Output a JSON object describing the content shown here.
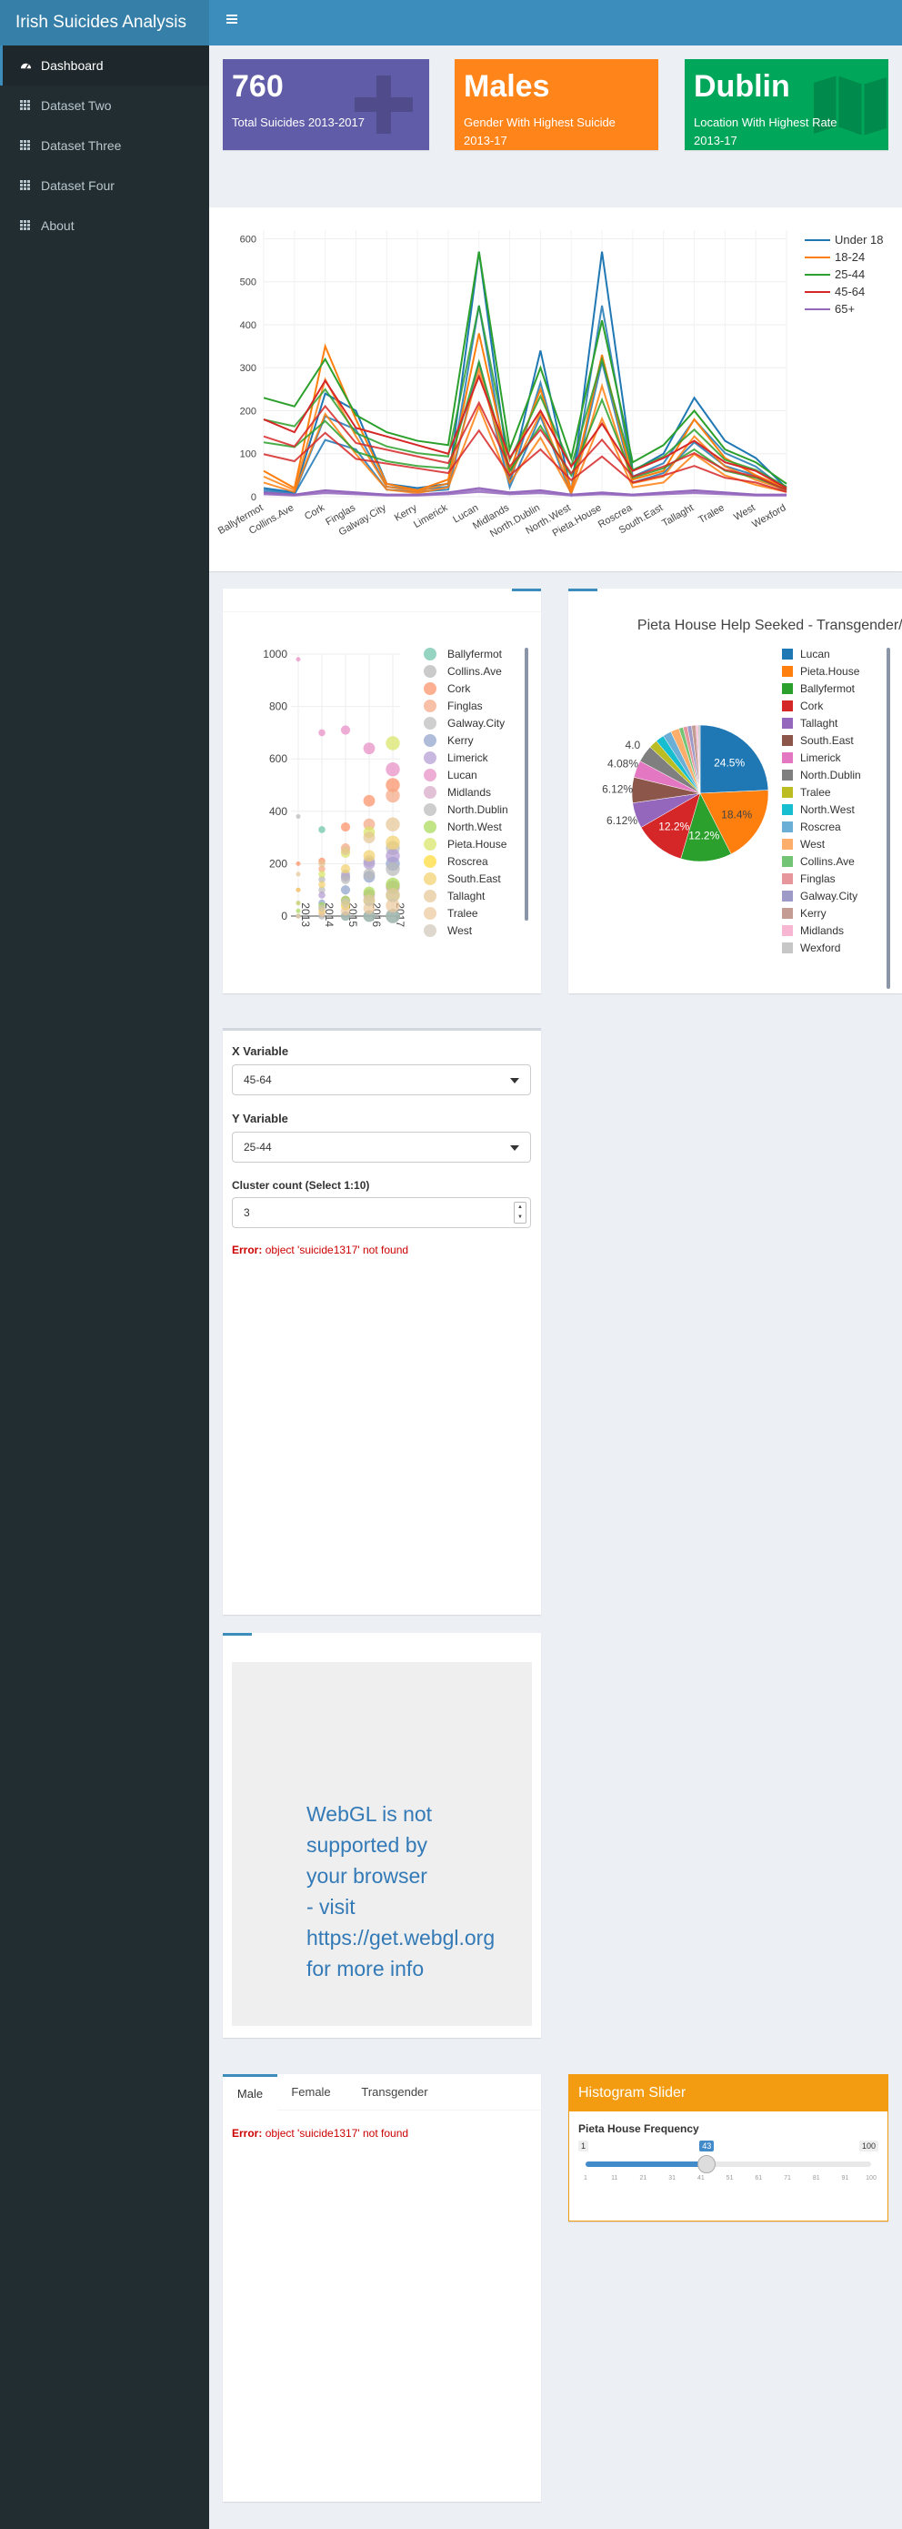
{
  "app": {
    "title": "Irish Suicides Analysis",
    "toggle_icon": "hamburger-icon"
  },
  "sidebar": {
    "items": [
      {
        "label": "Dashboard",
        "icon": "dashboard-icon",
        "active": true
      },
      {
        "label": "Dataset Two",
        "icon": "grid-icon"
      },
      {
        "label": "Dataset Three",
        "icon": "grid-icon"
      },
      {
        "label": "Dataset Four",
        "icon": "grid-icon"
      },
      {
        "label": "About",
        "icon": "grid-icon"
      }
    ]
  },
  "value_boxes": [
    {
      "value": "760",
      "subtitle": "Total Suicides 2013-2017",
      "color": "#605ca8",
      "icon": "plus-icon"
    },
    {
      "value": "Males",
      "subtitle": "Gender With Highest Suicide 2013-17",
      "color": "#ff851b",
      "icon": "none"
    },
    {
      "value": "Dublin",
      "subtitle": "Location With Highest Rate 2013-17",
      "color": "#00a65a",
      "icon": "map-icon"
    }
  ],
  "colors": {
    "accent": "#3c8dbc",
    "sidebar": "#222d32",
    "header": "#3c8dbc",
    "error": "#cc0000",
    "warning": "#f39c12"
  },
  "chart_data": [
    {
      "type": "line",
      "x": [
        "Ballyfermot",
        "Collins.Ave",
        "Cork",
        "Finglas",
        "Galway.City",
        "Kerry",
        "Limerick",
        "Lucan",
        "Midlands",
        "North.Dublin",
        "North.West",
        "Pieta.House",
        "Roscrea",
        "South.East",
        "Tallaght",
        "Tralee",
        "West",
        "Wexford"
      ],
      "ylim": [
        0,
        620
      ],
      "yticks": [
        0,
        100,
        200,
        300,
        400,
        500,
        600
      ],
      "series": [
        {
          "name": "Under 18",
          "color": "#1f77b4",
          "values": [
            20,
            10,
            240,
            200,
            30,
            20,
            30,
            570,
            40,
            340,
            10,
            570,
            60,
            100,
            230,
            130,
            90,
            20
          ]
        },
        {
          "name": "18-24",
          "color": "#ff7f0e",
          "values": [
            60,
            20,
            350,
            180,
            30,
            15,
            40,
            380,
            60,
            250,
            15,
            330,
            40,
            60,
            180,
            90,
            50,
            20
          ]
        },
        {
          "name": "25-44",
          "color": "#2ca02c",
          "values": [
            230,
            210,
            320,
            190,
            150,
            130,
            120,
            570,
            110,
            300,
            90,
            410,
            80,
            120,
            200,
            110,
            80,
            30
          ]
        },
        {
          "name": "45-64",
          "color": "#d62728",
          "values": [
            180,
            150,
            270,
            160,
            140,
            120,
            100,
            280,
            90,
            200,
            70,
            170,
            60,
            90,
            130,
            80,
            60,
            20
          ]
        },
        {
          "name": "65+",
          "color": "#9467bd",
          "values": [
            10,
            5,
            15,
            10,
            5,
            5,
            10,
            20,
            10,
            15,
            5,
            10,
            5,
            10,
            15,
            10,
            5,
            5
          ]
        }
      ],
      "legend": "top-right"
    },
    {
      "type": "scatter",
      "x": [
        "2013",
        "2014",
        "2015",
        "2016",
        "2017"
      ],
      "ylim": [
        0,
        1000
      ],
      "yticks": [
        0,
        200,
        400,
        600,
        800,
        1000
      ],
      "series": [
        {
          "name": "Ballyfermot",
          "color": "#66c2a5",
          "values": [
            0,
            330,
            0,
            0,
            0
          ]
        },
        {
          "name": "Collins.Ave",
          "color": "#b3b3b3",
          "values": [
            0,
            0,
            0,
            0,
            0
          ]
        },
        {
          "name": "Cork",
          "color": "#fc8d62",
          "values": [
            200,
            210,
            340,
            440,
            500
          ]
        },
        {
          "name": "Finglas",
          "color": "#f4a582",
          "values": [
            100,
            180,
            260,
            350,
            460
          ]
        },
        {
          "name": "Galway.City",
          "color": "#bbbbbb",
          "values": [
            0,
            100,
            160,
            210,
            260
          ]
        },
        {
          "name": "Kerry",
          "color": "#8da0cb",
          "values": [
            0,
            50,
            100,
            150,
            200
          ]
        },
        {
          "name": "Limerick",
          "color": "#b09ad1",
          "values": [
            50,
            80,
            150,
            200,
            230
          ]
        },
        {
          "name": "Lucan",
          "color": "#e78ac3",
          "values": [
            980,
            700,
            710,
            640,
            560
          ]
        },
        {
          "name": "Midlands",
          "color": "#d6a5c4",
          "values": [
            0,
            30,
            60,
            80,
            110
          ]
        },
        {
          "name": "North.Dublin",
          "color": "#b8b8b8",
          "values": [
            380,
            140,
            140,
            160,
            180
          ]
        },
        {
          "name": "North.West",
          "color": "#a6d854",
          "values": [
            20,
            40,
            60,
            90,
            120
          ]
        },
        {
          "name": "Pieta.House",
          "color": "#d8e462",
          "values": [
            50,
            160,
            240,
            320,
            660
          ]
        },
        {
          "name": "Roscrea",
          "color": "#ffd92f",
          "values": [
            0,
            20,
            40,
            60,
            80
          ]
        },
        {
          "name": "South.East",
          "color": "#f2d06b",
          "values": [
            100,
            120,
            180,
            230,
            280
          ]
        },
        {
          "name": "Tallaght",
          "color": "#e5c494",
          "values": [
            160,
            200,
            250,
            300,
            350
          ]
        },
        {
          "name": "Tralee",
          "color": "#ebc89b",
          "values": [
            0,
            10,
            20,
            30,
            40
          ]
        },
        {
          "name": "West",
          "color": "#cfc6b8",
          "values": [
            0,
            30,
            50,
            60,
            80
          ]
        }
      ]
    },
    {
      "type": "pie",
      "title": "Pieta House Help Seeked - Transgender/Location",
      "labels": [
        "Lucan",
        "Pieta.House",
        "Ballyfermot",
        "Cork",
        "Tallaght",
        "South.East",
        "Limerick",
        "North.Dublin",
        "Tralee",
        "North.West",
        "Roscrea",
        "West",
        "Collins.Ave",
        "Finglas",
        "Galway.City",
        "Kerry",
        "Midlands",
        "Wexford"
      ],
      "values": [
        24.5,
        18.4,
        12.2,
        12.2,
        6.12,
        6.12,
        4.08,
        4.08,
        2.04,
        2.04,
        2.04,
        2.04,
        1.02,
        1.02,
        1.02,
        1.02,
        0.51,
        0.51
      ],
      "colors": [
        "#1f77b4",
        "#ff7f0e",
        "#2ca02c",
        "#d62728",
        "#9467bd",
        "#8c564b",
        "#e377c2",
        "#7f7f7f",
        "#bcbd22",
        "#17becf",
        "#6baed6",
        "#fdae6b",
        "#74c476",
        "#e7969c",
        "#9e9ac8",
        "#c49c94",
        "#f7b6d2",
        "#c7c7c7"
      ],
      "shown_labels": [
        "24.5%",
        "18.4%",
        "12.2%",
        "12.2%",
        "6.12%",
        "6.12%",
        "4.08%",
        "4.0"
      ]
    }
  ],
  "kmeans": {
    "x_label": "X Variable",
    "x_value": "45-64",
    "y_label": "Y Variable",
    "y_value": "25-44",
    "k_label": "Cluster count (Select 1:10)",
    "k_value": "3",
    "error_prefix": "Error:",
    "error_message": "object 'suicide1317' not found"
  },
  "webgl": {
    "message": "WebGL is not\nsupported by\nyour browser\n- visit\nhttps://get.webgl.org\nfor more info"
  },
  "gender_tabs": {
    "tabs": [
      "Male",
      "Female",
      "Transgender"
    ],
    "error_prefix": "Error:",
    "error_message": "object 'suicide1317' not found"
  },
  "histogram": {
    "title": "Histogram Slider",
    "label": "Pieta House Frequency",
    "min": 1,
    "max": 100,
    "value": 43,
    "ticks": [
      "1",
      "11",
      "21",
      "31",
      "41",
      "51",
      "61",
      "71",
      "81",
      "91",
      "100"
    ]
  }
}
